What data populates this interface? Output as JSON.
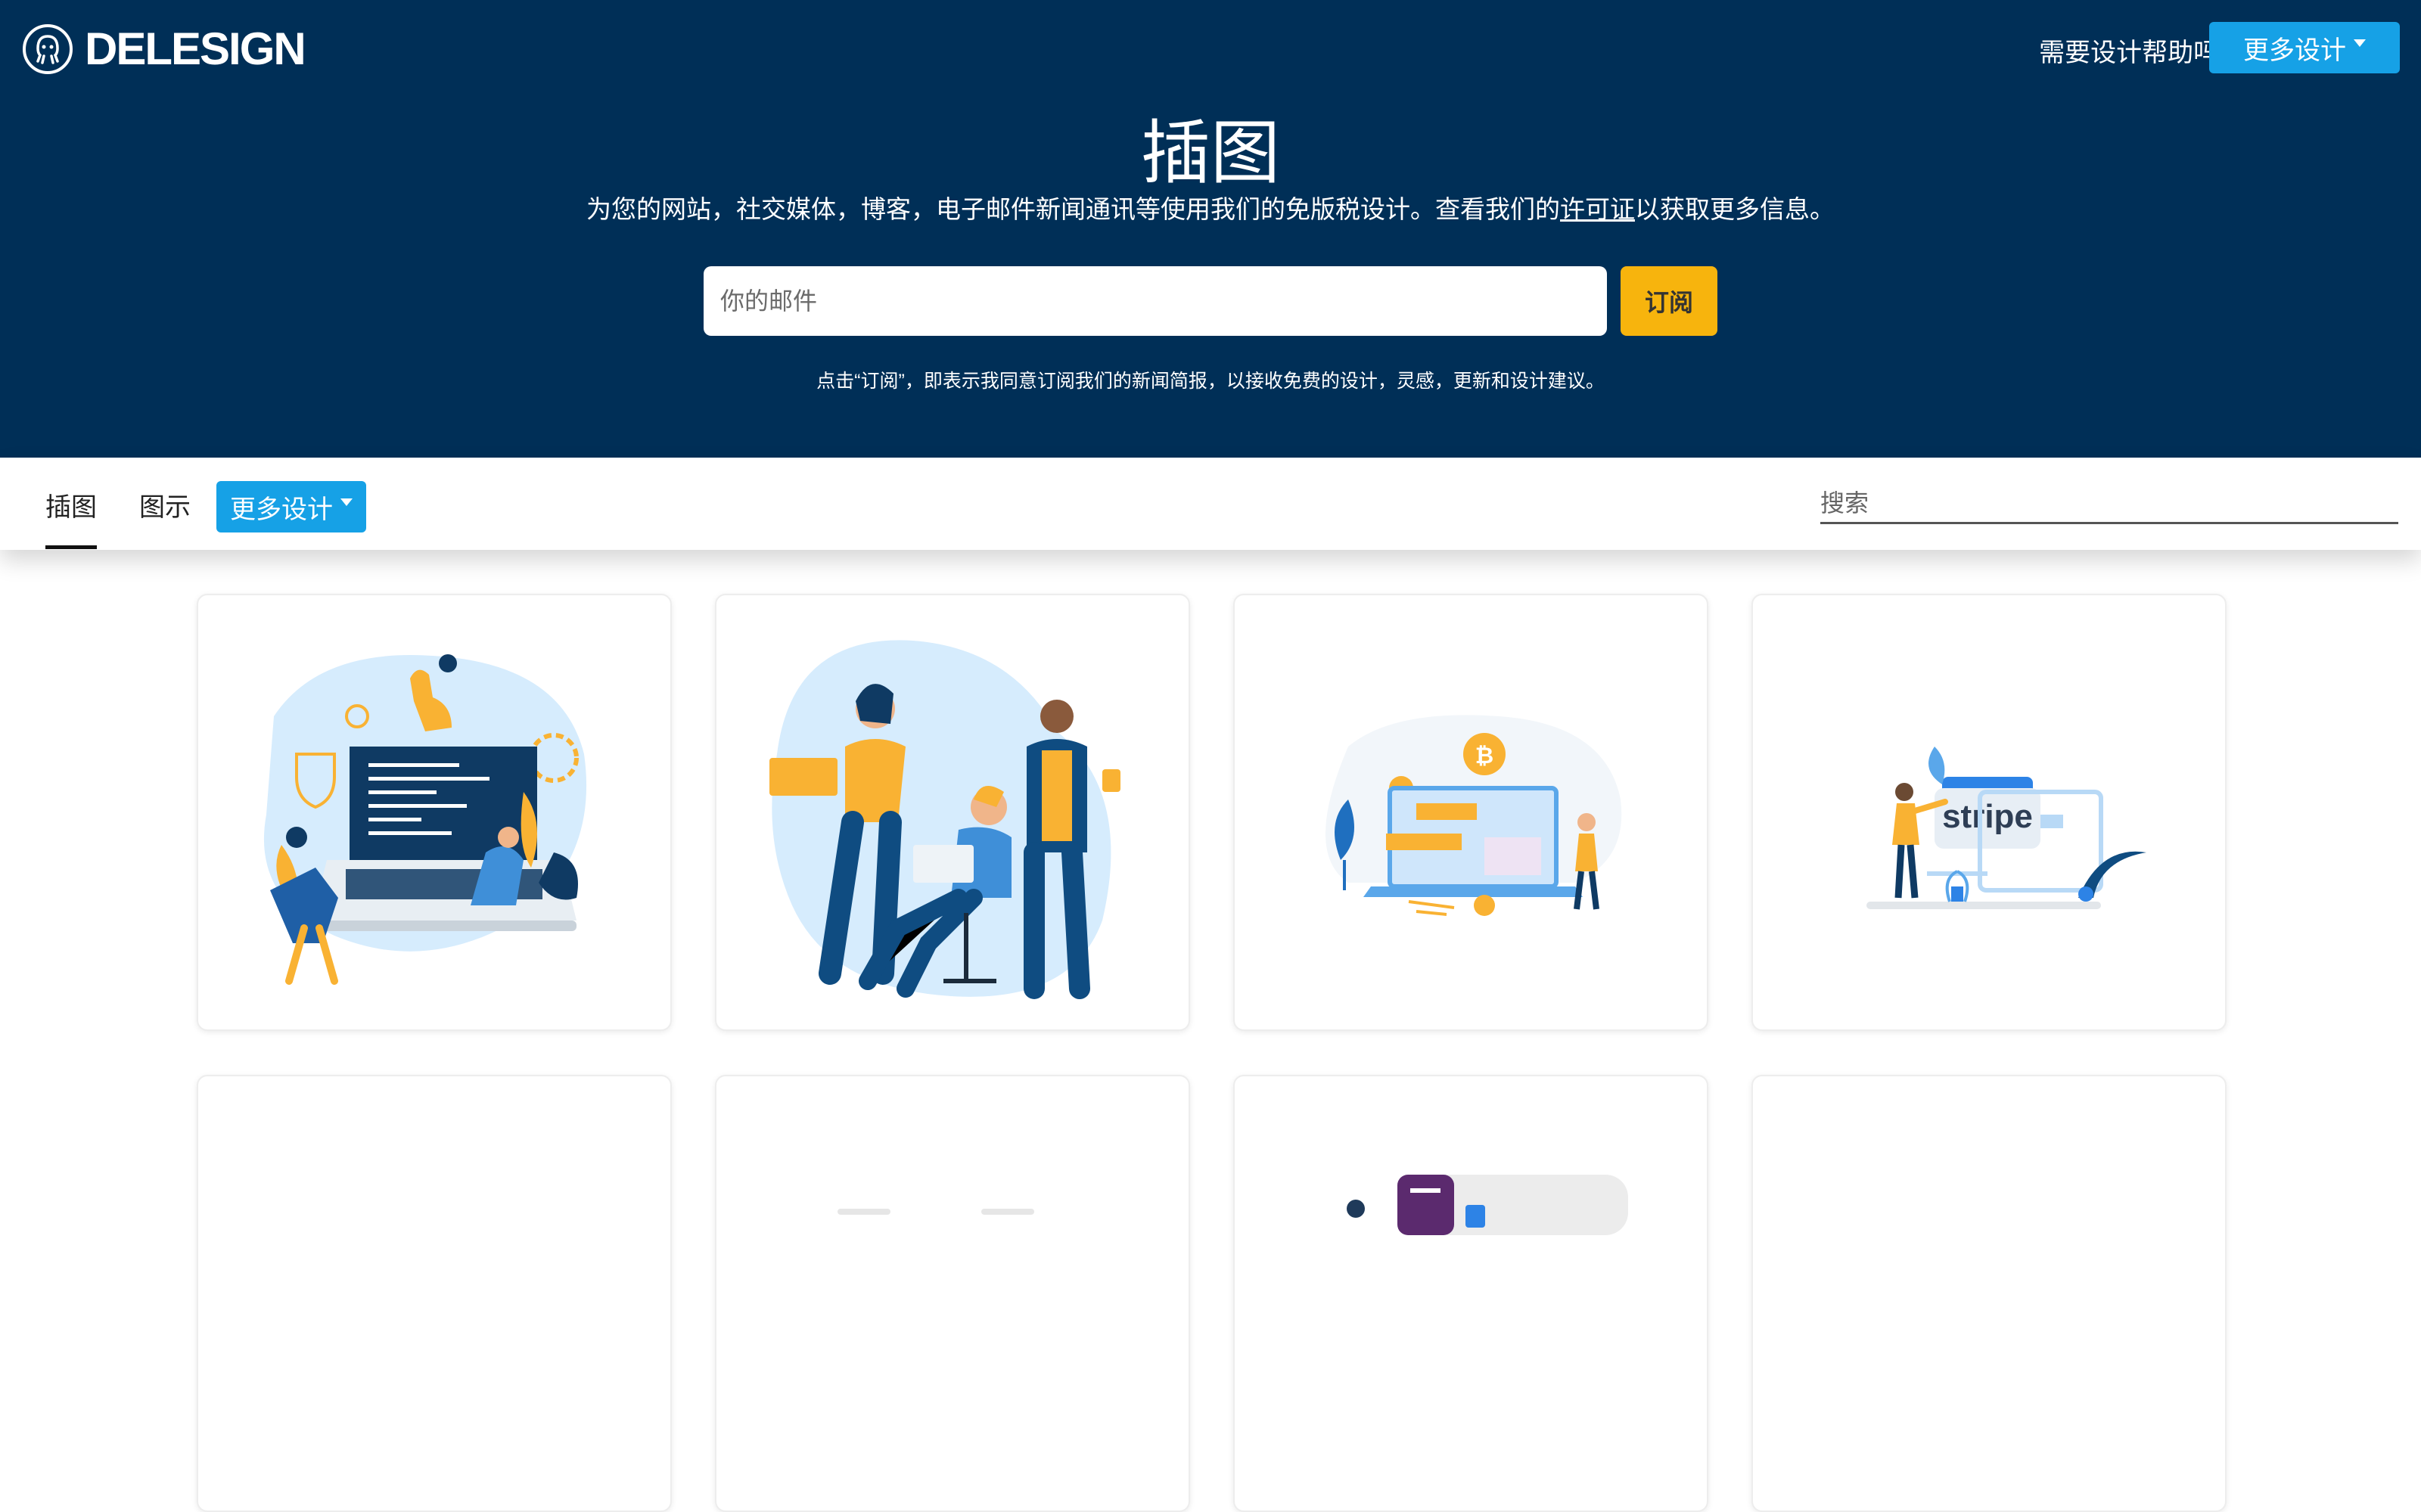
{
  "header": {
    "logo_text": "DELESIGN",
    "help_text": "需要设计帮助吗?",
    "more_designs_label": "更多设计"
  },
  "hero": {
    "title": "插图",
    "subtitle_before": "为您的网站，社交媒体，博客，电子邮件新闻通讯等使用我们的免版税设计。查看我们的",
    "license_link": "许可证",
    "subtitle_after": "以获取更多信息。",
    "email_placeholder": "你的邮件",
    "subscribe_label": "订阅",
    "consent_text": "点击“订阅”，即表示我同意订阅我们的新闻简报，以接收免费的设计，灵感，更新和设计建议。"
  },
  "nav": {
    "tabs": [
      {
        "label": "插图",
        "active": true
      },
      {
        "label": "图示",
        "active": false
      }
    ],
    "more_designs_label": "更多设计",
    "search_placeholder": "搜索"
  },
  "cards": {
    "stripe_logo_text": "stripe"
  },
  "colors": {
    "hero_bg": "#002f57",
    "accent_blue": "#16a1e6",
    "accent_yellow": "#f7b40d",
    "illus_navy": "#0f4c81",
    "illus_yellow": "#f9b233",
    "illus_light_blue": "#d6ecfd"
  }
}
